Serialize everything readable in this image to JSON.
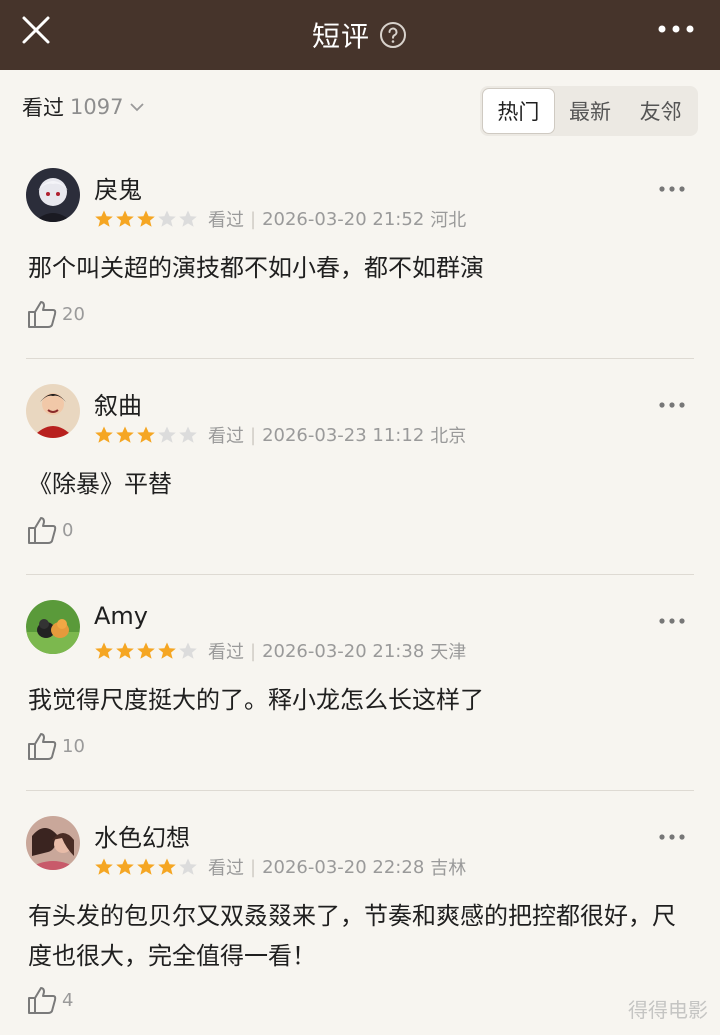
{
  "header": {
    "title": "短评",
    "icons": [
      "close-icon",
      "help-icon",
      "more-icon"
    ]
  },
  "subbar": {
    "seen_label": "看过",
    "seen_count": "1097",
    "tabs": [
      "热门",
      "最新",
      "友邻"
    ],
    "active_tab": "热门"
  },
  "colors": {
    "header_bg": "#46342b",
    "star_filled": "#f5a623",
    "star_empty": "#dcdcdc",
    "page_bg": "#f7f5f0"
  },
  "comments": [
    {
      "name": "戾鬼",
      "rating": 3,
      "status": "看过",
      "time": "2026-03-20 21:52",
      "location": "河北",
      "text": "那个叫关超的演技都不如小春，都不如群演",
      "likes": "20"
    },
    {
      "name": "叙曲",
      "rating": 3,
      "status": "看过",
      "time": "2026-03-23 11:12",
      "location": "北京",
      "text": "《除暴》平替",
      "likes": "0"
    },
    {
      "name": "Amy",
      "rating": 4,
      "status": "看过",
      "time": "2026-03-20 21:38",
      "location": "天津",
      "text": "我觉得尺度挺大的了。释小龙怎么长这样了",
      "likes": "10"
    },
    {
      "name": "水色幻想",
      "rating": 4,
      "status": "看过",
      "time": "2026-03-20 22:28",
      "location": "吉林",
      "text": "有头发的包贝尔又双叒叕来了，节奏和爽感的把控都很好，尺度也很大，完全值得一看！",
      "likes": "4"
    }
  ],
  "watermark": "得得电影"
}
